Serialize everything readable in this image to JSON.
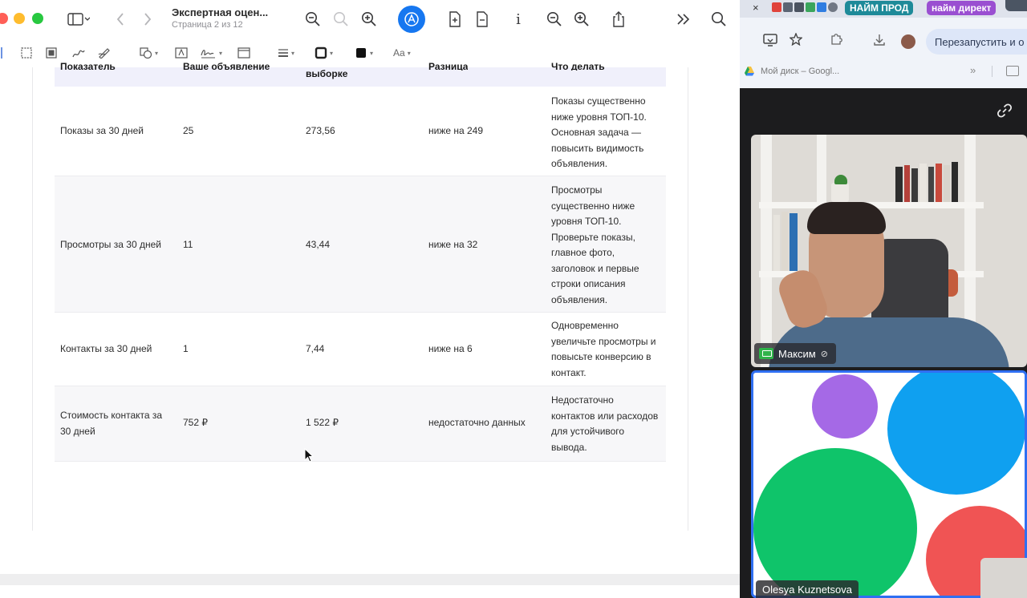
{
  "viewer": {
    "title": "Экспертная оцен...",
    "subtitle": "Страница 2 из 12",
    "info_glyph": "i",
    "font_button": "Aa",
    "table": {
      "header_partial": [
        "Показатель",
        "Ваше объявление",
        "выборке",
        "Разница",
        "Что делать"
      ],
      "rows": [
        {
          "metric": "Показы за 30 дней",
          "yours": "25",
          "sample": "273,56",
          "difference": "ниже на 249",
          "action_lines": [
            "Показы существенно",
            "ниже уровня ТОП-10.",
            "Основная задача —",
            "повысить видимость",
            "объявления."
          ]
        },
        {
          "metric": "Просмотры за 30 дней",
          "yours": "11",
          "sample": "43,44",
          "difference": "ниже на 32",
          "action_lines": [
            "Просмотры",
            "существенно ниже",
            "уровня ТОП-10.",
            "Проверьте показы,",
            "главное фото,",
            "заголовок и первые",
            "строки описания",
            "объявления."
          ]
        },
        {
          "metric": "Контакты за 30 дней",
          "yours": "1",
          "sample": "7,44",
          "difference": "ниже на 6",
          "action_lines": [
            "Одновременно",
            "увеличьте просмотры и",
            "повысьте конверсию в",
            "контакт."
          ]
        },
        {
          "metric_lines": [
            "Стоимость контакта за",
            "30 дней"
          ],
          "yours": "752 ₽",
          "sample": "1 522 ₽",
          "difference": "недостаточно данных",
          "action_lines": [
            "Недостаточно",
            "контактов или расходов",
            "для устойчивого",
            "вывода."
          ]
        }
      ]
    }
  },
  "browser": {
    "tab_close": "×",
    "pill_prod": "НАЙМ ПРОД",
    "pill_direct": "найм директ",
    "restart_button": "Перезапустить и о",
    "bookmark_drive": "Мой диск – Googl...",
    "bookmarks_more": "»"
  },
  "call": {
    "participant_1": "Максим",
    "participant_2": "Olesya Kuznetsova",
    "mute_glyph": "⊘"
  },
  "colors": {
    "accent_blue": "#1677f0",
    "tile_border": "#2f6ff2",
    "pill_prod": "#1e8a99",
    "pill_direct": "#9a4fd1",
    "circle_purple": "#a569e6",
    "circle_blue": "#0fa0f0",
    "circle_green": "#0fc46a",
    "circle_red": "#f05454"
  }
}
